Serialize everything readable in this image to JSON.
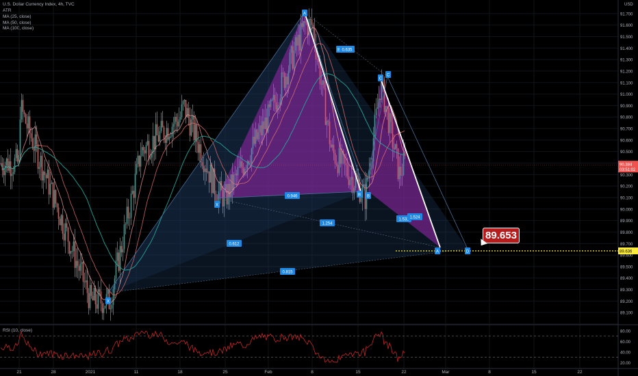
{
  "header": {
    "title": "U.S. Dollar Currency Index, 4h, TVC",
    "indicators": [
      "ATR",
      "MA (25, close)",
      "MA (50, close)",
      "MA (100, close)"
    ]
  },
  "rsi": {
    "legend": "RSI (10, close)",
    "ticks": [
      "80.00",
      "60.00",
      "40.00",
      "20.00"
    ]
  },
  "target_label": "89.653",
  "colors": {
    "background": "#000000",
    "up_candle": "#26a69a",
    "down_candle": "#ef5350",
    "pattern_fill": "#9c27b0",
    "pattern_envelope": "#1e3a5f",
    "ma25": "#ef9a9a",
    "ma50": "#e57373",
    "ma100": "#26a69a",
    "rsi_line": "#c62828",
    "target_box": "#b71c1c",
    "price_line": "#ffeb3b"
  },
  "chart_data": {
    "type": "candlestick",
    "title": "U.S. Dollar Currency Index, 4h, TVC",
    "y_axis_label": "USD",
    "ylim": [
      89.0,
      91.8
    ],
    "yticks": [
      "91.700",
      "91.600",
      "91.500",
      "91.400",
      "91.300",
      "91.200",
      "91.100",
      "91.000",
      "90.900",
      "90.800",
      "90.700",
      "90.600",
      "90.500",
      "90.400",
      "90.300",
      "90.200",
      "90.100",
      "90.000",
      "89.900",
      "89.800",
      "89.700",
      "89.600",
      "89.500",
      "89.400",
      "89.300",
      "89.200",
      "89.100",
      "89.000"
    ],
    "xticks": [
      "21",
      "28",
      "2021",
      "11",
      "18",
      "25",
      "Feb",
      "8",
      "15",
      "22",
      "Mar",
      "8",
      "15",
      "22"
    ],
    "current_price": {
      "value": "90.384",
      "countdown": "03:51:02"
    },
    "target_price_axis": "89.636",
    "price_path": [
      [
        "21",
        90.9
      ],
      [
        "28",
        90.1
      ],
      [
        "2021",
        89.2
      ],
      [
        "11",
        90.3
      ],
      [
        "18",
        90.8
      ],
      [
        "25",
        90.1
      ],
      [
        "Feb",
        90.8
      ],
      [
        "8",
        91.6
      ],
      [
        "15",
        90.2
      ],
      [
        "22",
        90.4
      ]
    ],
    "pattern_points": [
      {
        "label": "X",
        "price": 89.2
      },
      {
        "label": "A",
        "price": 91.6
      },
      {
        "label": "B",
        "price": 90.1
      },
      {
        "label": "C",
        "price": 91.1
      },
      {
        "label": "D",
        "price": 89.64
      }
    ],
    "ratios": [
      "0.635",
      "0.946",
      "1.254",
      "0.612",
      "0.815",
      "1.533",
      "1.524"
    ],
    "target": "89.653",
    "rsi_period": 10
  }
}
